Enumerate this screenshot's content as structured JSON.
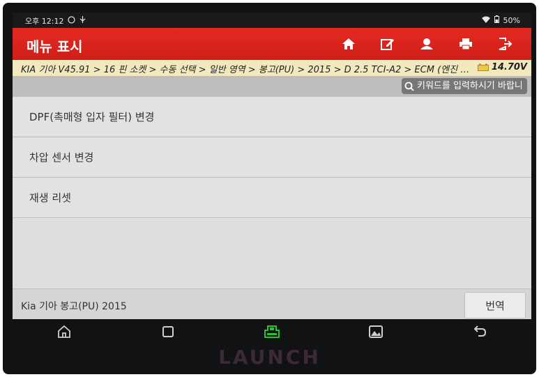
{
  "status_bar": {
    "time": "오후 12:12",
    "battery": "50%"
  },
  "header": {
    "title": "메뉴 표시"
  },
  "toolbar": {
    "icons": [
      "home-icon",
      "edit-icon",
      "user-icon",
      "print-icon",
      "exit-icon"
    ]
  },
  "breadcrumb": {
    "path": "KIA 기아 V45.91 > 16 핀 소켓 > 수동 선택 > 일반 영역 > 봉고(PU) > 2015 > D 2.5 TCI-A2 > ECM (엔진 컨...",
    "voltage": "14.70V"
  },
  "search": {
    "placeholder": "키워드를 입력하시기 바랍니다"
  },
  "menu": {
    "items": [
      {
        "label": "DPF(촉매형 입자 필터) 변경"
      },
      {
        "label": "차압 센서 변경"
      },
      {
        "label": "재생 리셋"
      }
    ]
  },
  "footer": {
    "vehicle": "Kia 기아 봉고(PU) 2015",
    "translate_label": "번역"
  },
  "navbar": {
    "icons": [
      "home-icon",
      "recent-apps-icon",
      "vci-icon",
      "screenshot-icon",
      "back-icon"
    ]
  },
  "brand": {
    "name": "LAUNCH"
  },
  "colors": {
    "header": "#d8221b",
    "breadcrumb_bg": "#f2e9bf",
    "vci_green": "#2fbf2f"
  }
}
